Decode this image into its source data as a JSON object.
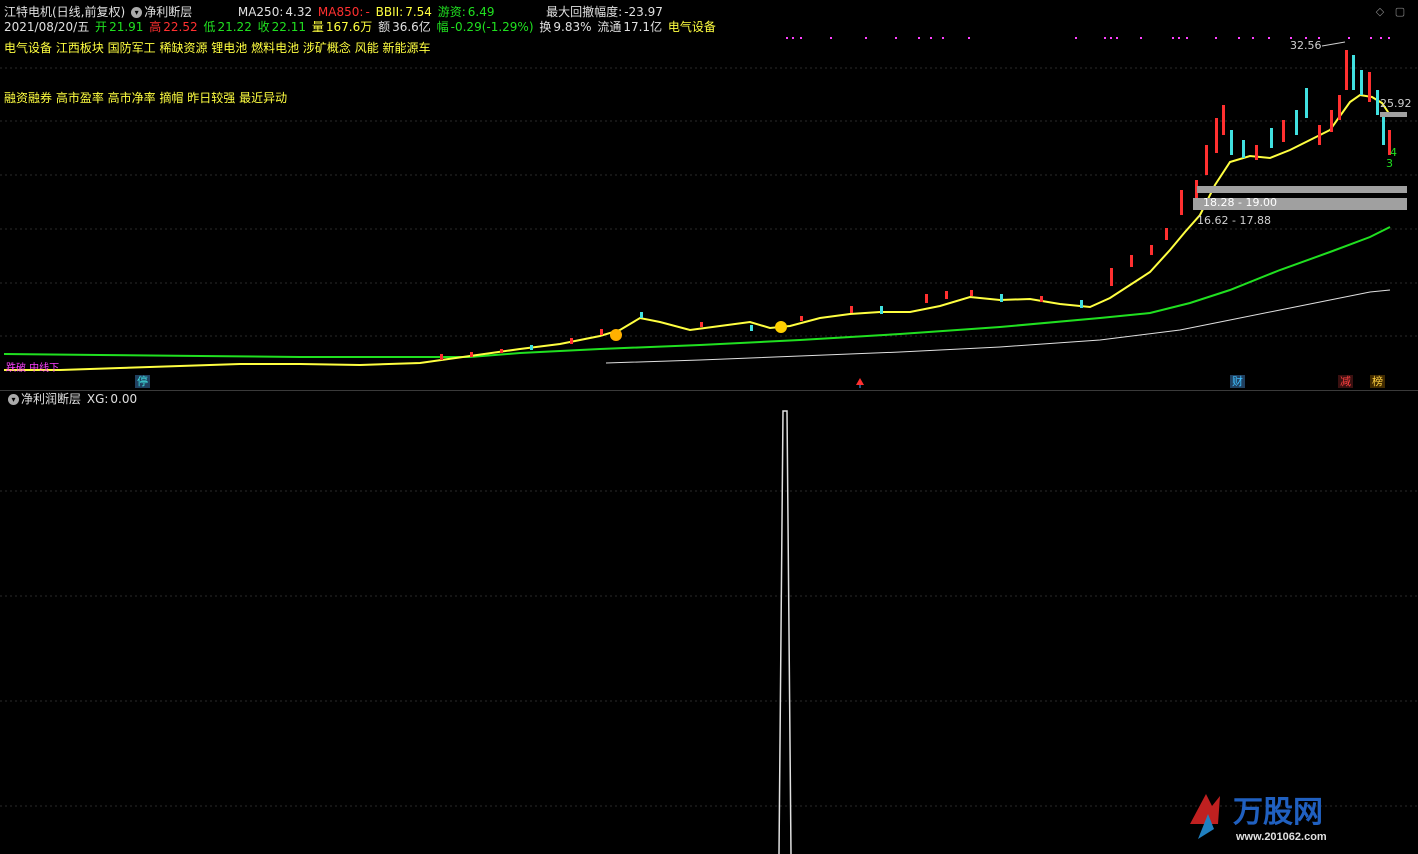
{
  "header": {
    "stock_title": "江特电机(日线,前复权)",
    "indicator_name": "净利断层",
    "ma250_label": "MA250:",
    "ma250_value": "4.32",
    "ma850_label": "MA850:",
    "ma850_value": "-",
    "bbii_label": "BBII:",
    "bbii_value": "7.54",
    "youzi_label": "游资:",
    "youzi_value": "6.49",
    "drawdown_label": "最大回撤幅度:",
    "drawdown_value": "-23.97"
  },
  "quote": {
    "date": "2021/08/20/五",
    "open_label": "开",
    "open": "21.91",
    "high_label": "高",
    "high": "22.52",
    "low_label": "低",
    "low": "21.22",
    "close_label": "收",
    "close": "22.11",
    "vol_label": "量",
    "vol": "167.6万",
    "amount_label": "额",
    "amount": "36.6亿",
    "change_label": "幅",
    "change": "-0.29(-1.29%)",
    "turnover_label": "换",
    "turnover": "9.83%",
    "float_label": "流通",
    "float": "17.1亿",
    "sector": "电气设备"
  },
  "concepts_line1": "电气设备 江西板块 国防军工 稀缺资源 锂电池 燃料电池 涉矿概念 风能 新能源车",
  "concepts_line2": "融资融券 高市盈率 高市净率 摘帽 昨日较强 最近异动",
  "price_labels": {
    "peak": "32.56",
    "right_price": "25.92",
    "zone1": "18.28 - 19.00",
    "zone2": "16.62 - 17.88",
    "count_a": "4",
    "count_b": "3"
  },
  "bottom_tags": {
    "stop": "停",
    "finance": "财",
    "reduce": "减",
    "rank": "榜"
  },
  "left_marks": "跌破 中线下",
  "sub_indicator": {
    "name": "净利润断层",
    "xg_label": "XG:",
    "xg_value": "0.00"
  },
  "logo": {
    "brand": "万股网",
    "url": "www.201062.com"
  },
  "colors": {
    "background": "#000000",
    "ma_yellow": "#ffff40",
    "ma_green": "#20e020",
    "ma_white": "#e0e0e0",
    "up_red": "#ff3030",
    "down_cyan": "#40e0e0",
    "magenta": "#ff40ff"
  }
}
